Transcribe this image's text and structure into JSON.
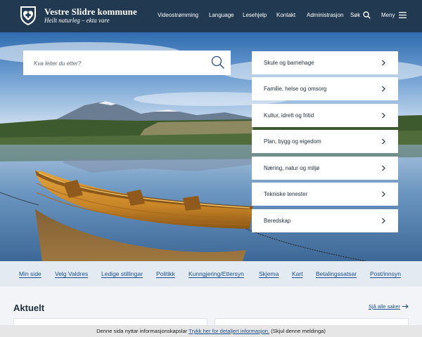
{
  "header": {
    "site_name": "Vestre Slidre kommune",
    "tagline": "Heilt naturleg – ekta vare",
    "nav": [
      "Videostrømming",
      "Language",
      "Lesehjelp",
      "Kontakt",
      "Administrasjon"
    ],
    "search_label": "Søk",
    "menu_label": "Meny"
  },
  "search": {
    "placeholder": "Kva leiter du etter?"
  },
  "categories": [
    "Skule og barnehage",
    "Familie, helse og omsorg",
    "Kultur, idrett og fritid",
    "Plan, bygg og eigedom",
    "Næring, natur og miljø",
    "Tekniske tenester",
    "Beredskap"
  ],
  "quicklinks": [
    "Min side",
    "Velg Valdres",
    "Ledige stillingar",
    "Politikk",
    "Kunngjering/Ettersyn",
    "Skjema",
    "Kart",
    "Betalingssatsar",
    "Post/innsyn"
  ],
  "aktuelt": {
    "title": "Aktuelt",
    "see_all": "Sjå alle saker"
  },
  "cookie": {
    "text_before": "Denne sida nyttar informasjonskapslar ",
    "link": "Trykk her for detaljert informasjon.",
    "text_after": " (Skjul denne meldinga)"
  },
  "icons": {
    "logo": "heart-cross-logo",
    "search": "search-icon",
    "menu": "hamburger-icon",
    "chevron": "chevron-right-icon",
    "arrow": "arrow-right-icon"
  },
  "colors": {
    "header_bg": "#213a51",
    "link": "#1a4e8e",
    "quicklinks_bg": "#e3eaf2"
  }
}
